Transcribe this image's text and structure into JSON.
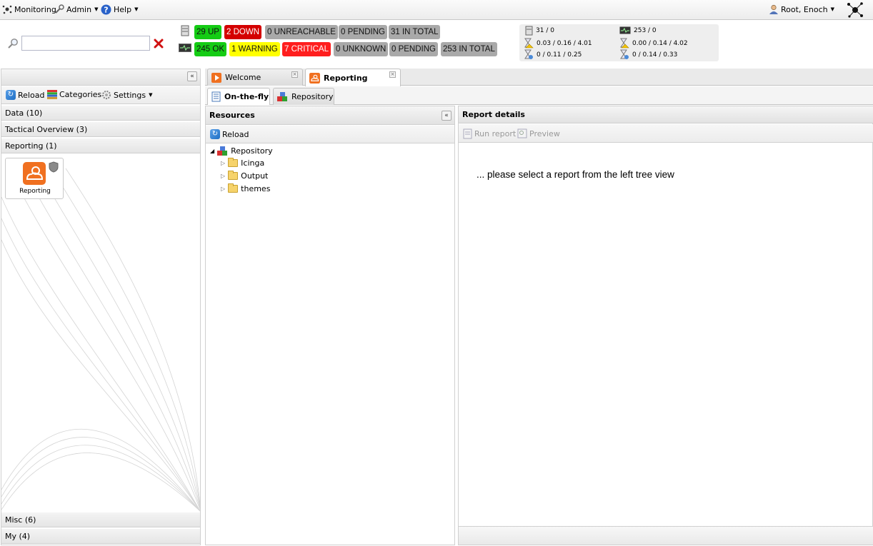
{
  "menu": {
    "monitoring": "Monitoring",
    "admin": "Admin",
    "help": "Help",
    "user": "Root, Enoch"
  },
  "status": {
    "hosts": [
      "29 UP",
      "2 DOWN",
      "0 UNREACHABLE",
      "0 PENDING",
      "31 IN TOTAL"
    ],
    "services": [
      "245 OK",
      "1 WARNING",
      "7 CRITICAL",
      "0 UNKNOWN",
      "0 PENDING",
      "253 IN TOTAL"
    ]
  },
  "perf": {
    "host_count": "31 / 0",
    "service_count": "253 / 0",
    "host_latency": "0.03 / 0.16 / 4.01",
    "service_latency": "0.00 / 0.14 / 4.02",
    "host_exec": "0 / 0.11 / 0.25",
    "service_exec": "0 / 0.14 / 0.33"
  },
  "sidebar": {
    "toolbar": {
      "reload": "Reload",
      "categories": "Categories",
      "settings": "Settings"
    },
    "sections": {
      "data": "Data (10)",
      "tactical": "Tactical Overview (3)",
      "reporting": "Reporting (1)",
      "misc": "Misc (6)",
      "my": "My (4)"
    },
    "cronk": {
      "label": "Reporting"
    }
  },
  "tabs": {
    "welcome": "Welcome",
    "reporting": "Reporting"
  },
  "subtabs": {
    "onthefly": "On-the-fly",
    "repository": "Repository"
  },
  "resources": {
    "title": "Resources",
    "reload": "Reload",
    "tree": {
      "root": "Repository",
      "children": [
        "Icinga",
        "Output",
        "themes"
      ]
    }
  },
  "details": {
    "title": "Report details",
    "run": "Run report",
    "preview": "Preview",
    "message": "... please select a report from the left tree view"
  }
}
